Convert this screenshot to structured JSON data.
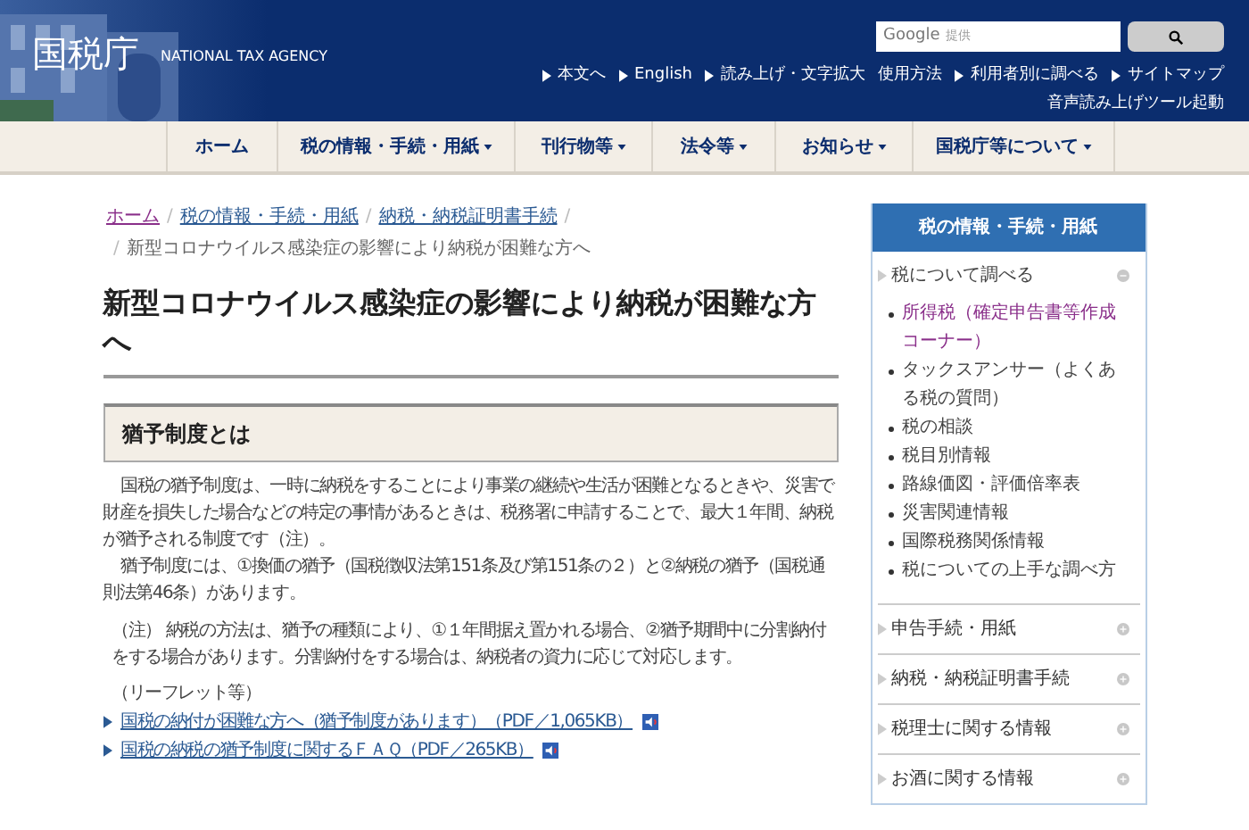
{
  "header": {
    "logo": "国税庁",
    "subtitle": "NATIONAL TAX AGENCY",
    "search": {
      "brand": "Google",
      "placeholder": "提供"
    },
    "links": [
      {
        "label": "本文へ",
        "arrow": true
      },
      {
        "label": "English",
        "arrow": true
      },
      {
        "label": "読み上げ・文字拡大",
        "arrow": true
      },
      {
        "label": "使用方法",
        "arrow": false
      },
      {
        "label": "利用者別に調べる",
        "arrow": true
      },
      {
        "label": "サイトマップ",
        "arrow": true
      }
    ],
    "tool_link": "音声読み上げツール起動"
  },
  "nav": [
    {
      "label": "ホーム",
      "dropdown": false
    },
    {
      "label": "税の情報・手続・用紙",
      "dropdown": true
    },
    {
      "label": "刊行物等",
      "dropdown": true
    },
    {
      "label": "法令等",
      "dropdown": true
    },
    {
      "label": "お知らせ",
      "dropdown": true
    },
    {
      "label": "国税庁等について",
      "dropdown": true
    }
  ],
  "breadcrumb": {
    "separator": "/",
    "links": [
      {
        "label": "ホーム",
        "visited": true
      },
      {
        "label": "税の情報・手続・用紙",
        "visited": false
      },
      {
        "label": "納税・納税証明書手続",
        "visited": false
      }
    ],
    "current": "新型コロナウイルス感染症の影響により納税が困難な方へ"
  },
  "title": "新型コロナウイルス感染症の影響により納税が困難な方へ",
  "section": {
    "heading": "猶予制度とは",
    "paragraphs": [
      "国税の猶予制度は、一時に納税をすることにより事業の継続や生活が困難となるときや、災害で財産を損失した場合などの特定の事情があるときは、税務署に申請することで、最大１年間、納税が猶予される制度です（注）。",
      "猶予制度には、①換価の猶予（国税徴収法第151条及び第151条の２）と②納税の猶予（国税通則法第46条）があります。"
    ],
    "note": "（注） 納税の方法は、猶予の種類により、①１年間据え置かれる場合、②猶予期間中に分割納付をする場合があります。分割納付をする場合は、納税者の資力に応じて対応します。",
    "leaflet_label": "（リーフレット等）",
    "links": [
      "国税の納付が困難な方へ（猶予制度があります）（PDF／1,065KB）",
      "国税の納税の猶予制度に関するＦＡＱ（PDF／265KB）"
    ]
  },
  "sidebar": {
    "title": "税の情報・手続・用紙",
    "groups": [
      {
        "label": "税について調べる",
        "expanded": true,
        "children": [
          {
            "label": "所得税（確定申告書等作成コーナー）",
            "visited": true
          },
          {
            "label": "タックスアンサー（よくある税の質問）",
            "visited": false
          },
          {
            "label": "税の相談",
            "visited": false
          },
          {
            "label": "税目別情報",
            "visited": false
          },
          {
            "label": "路線価図・評価倍率表",
            "visited": false
          },
          {
            "label": "災害関連情報",
            "visited": false
          },
          {
            "label": "国際税務関係情報",
            "visited": false
          },
          {
            "label": "税についての上手な調べ方",
            "visited": false
          }
        ]
      },
      {
        "label": "申告手続・用紙",
        "expanded": false
      },
      {
        "label": "納税・納税証明書手続",
        "expanded": false
      },
      {
        "label": "税理士に関する情報",
        "expanded": false
      },
      {
        "label": "お酒に関する情報",
        "expanded": false
      }
    ]
  }
}
